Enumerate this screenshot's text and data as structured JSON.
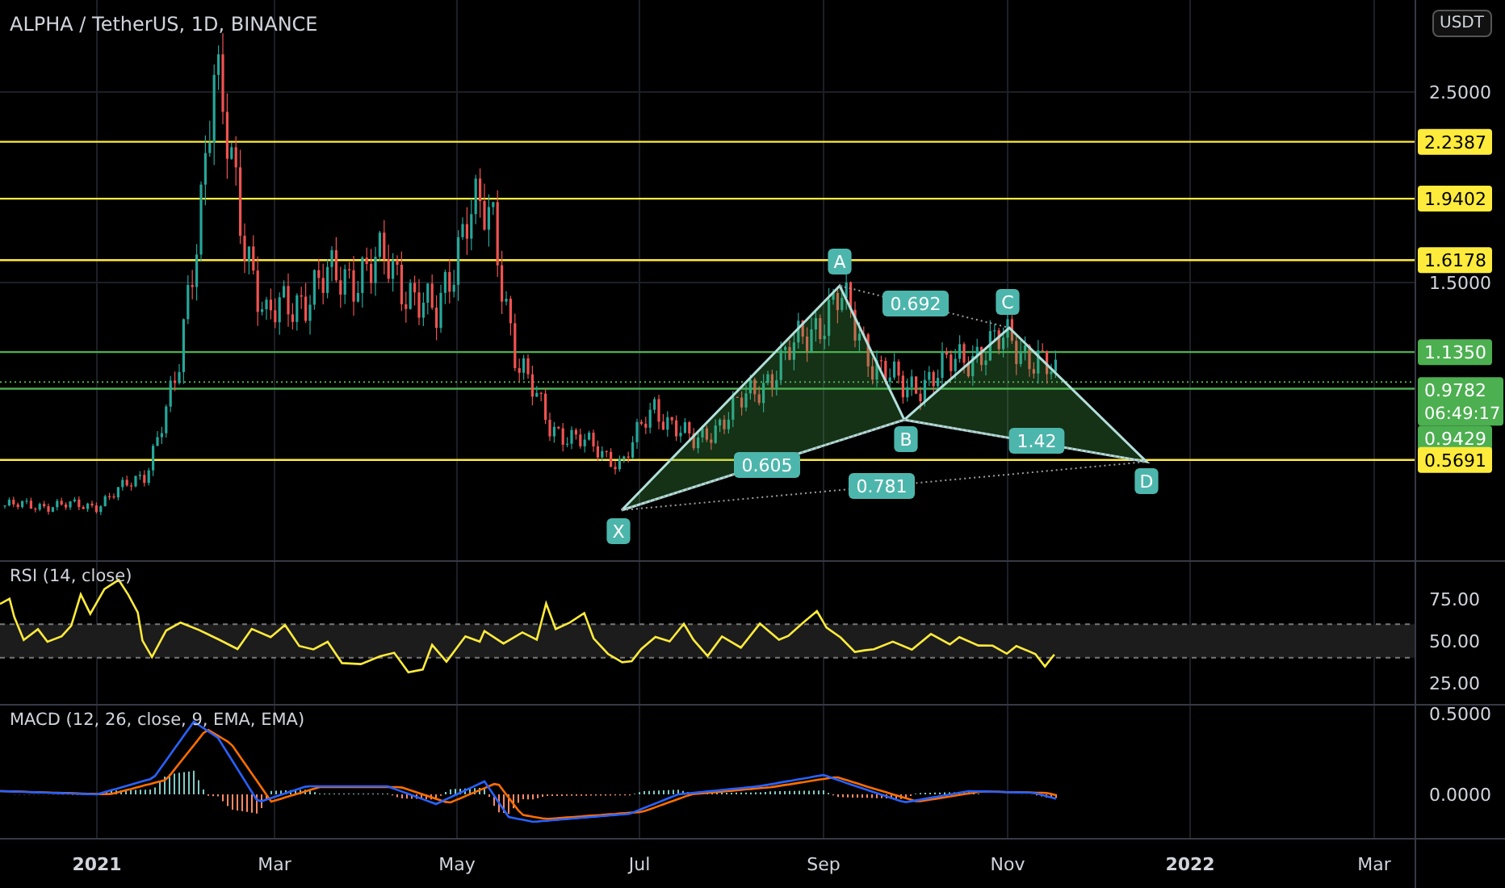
{
  "header": {
    "title": "ALPHA / TetherUS, 1D, BINANCE",
    "currency": "USDT"
  },
  "price_ticks": [
    "2.5000",
    "1.5000"
  ],
  "levels": [
    {
      "price": "2.2387",
      "color": "#ffeb3b"
    },
    {
      "price": "1.9402",
      "color": "#ffeb3b"
    },
    {
      "price": "1.6178",
      "color": "#ffeb3b"
    },
    {
      "price": "1.1350",
      "color": "#4caf50"
    },
    {
      "price": "0.9429",
      "color": "#4caf50"
    },
    {
      "price": "0.5691",
      "color": "#ffeb3b"
    }
  ],
  "current_price": {
    "price": "0.9782",
    "countdown": "06:49:17"
  },
  "pattern": {
    "points": [
      "X",
      "A",
      "B",
      "C",
      "D"
    ],
    "ratios": [
      "0.692",
      "0.605",
      "0.781",
      "1.42"
    ]
  },
  "rsi": {
    "label": "RSI (14, close)",
    "ticks": [
      "75.00",
      "50.00",
      "25.00"
    ]
  },
  "macd": {
    "label": "MACD (12, 26, close, 9, EMA, EMA)",
    "ticks": [
      "0.5000",
      "0.0000"
    ]
  },
  "time_axis": [
    {
      "label": "2021",
      "kind": "year"
    },
    {
      "label": "Mar",
      "kind": "month"
    },
    {
      "label": "May",
      "kind": "month"
    },
    {
      "label": "Jul",
      "kind": "month"
    },
    {
      "label": "Sep",
      "kind": "month"
    },
    {
      "label": "Nov",
      "kind": "month"
    },
    {
      "label": "2022",
      "kind": "year"
    },
    {
      "label": "Mar",
      "kind": "month"
    }
  ]
}
